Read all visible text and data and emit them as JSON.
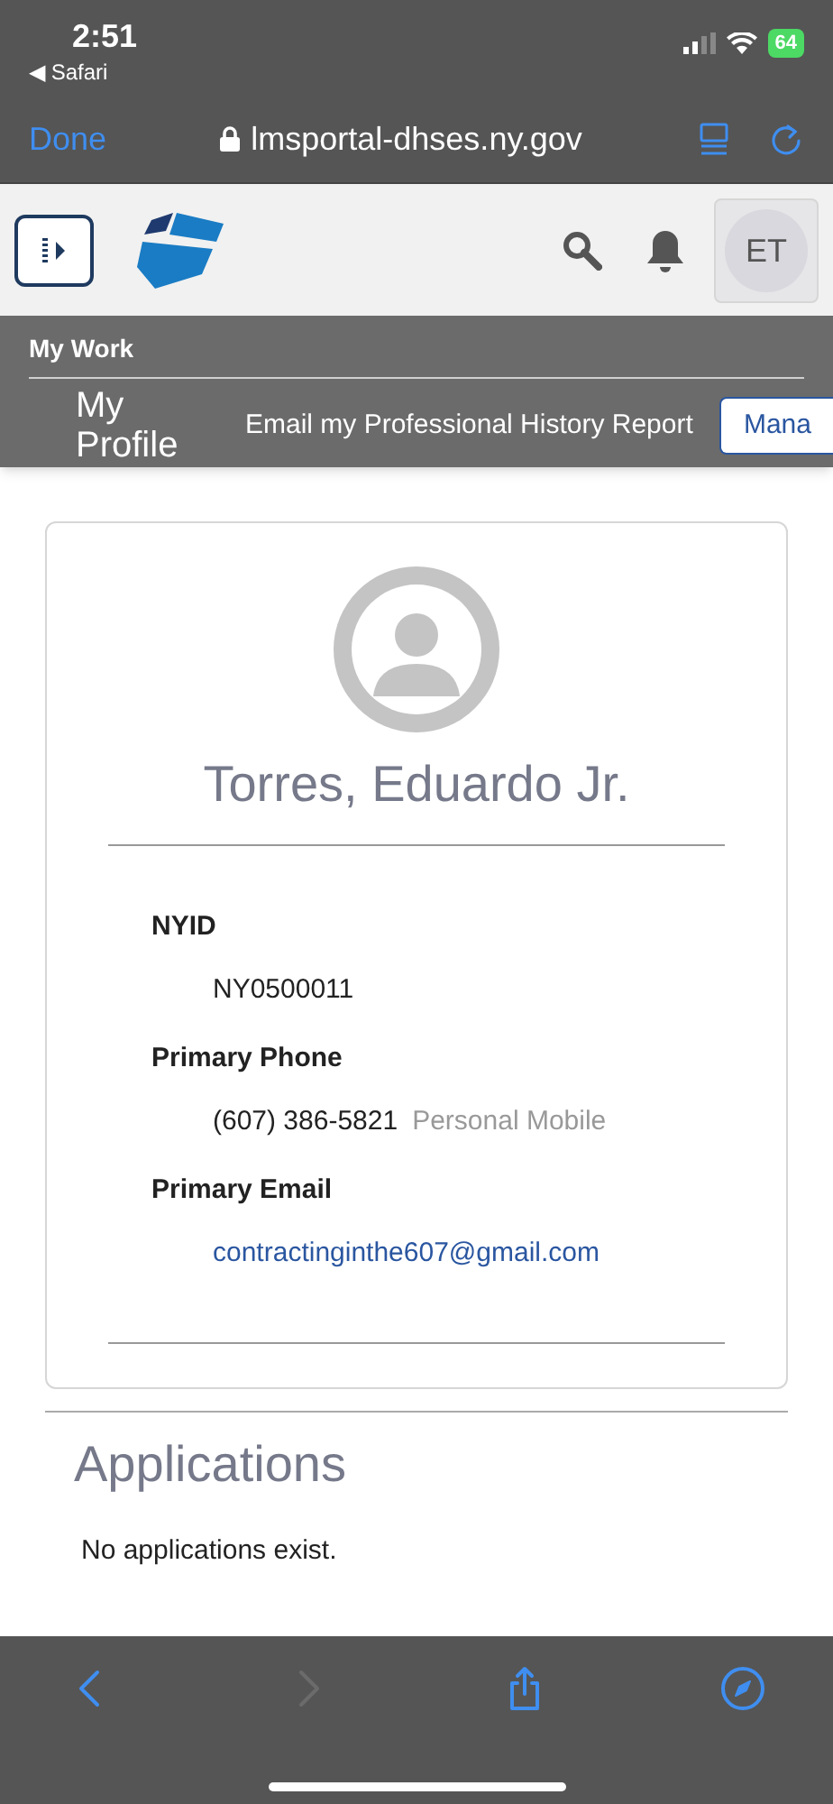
{
  "status_bar": {
    "time": "2:51",
    "back_app": "◀ Safari",
    "battery": "64"
  },
  "browser": {
    "done": "Done",
    "url": "lmsportal-dhses.ny.gov"
  },
  "header": {
    "avatar_initials": "ET"
  },
  "nav": {
    "section": "My Work",
    "page_title": "My Profile",
    "actions": [
      {
        "label": "Email my Professional History Report",
        "kind": "link"
      },
      {
        "label": "Mana",
        "kind": "button"
      }
    ]
  },
  "profile": {
    "name": "Torres, Eduardo Jr.",
    "fields": [
      {
        "label": "NYID",
        "value": "NY0500011",
        "kind": "text"
      },
      {
        "label": "Primary Phone",
        "value": "(607) 386-5821",
        "note": "Personal Mobile",
        "kind": "text"
      },
      {
        "label": "Primary Email",
        "value": "contractinginthe607@gmail.com",
        "kind": "link"
      }
    ]
  },
  "applications": {
    "title": "Applications",
    "empty_message": "No applications exist."
  },
  "toolbar": [
    {
      "kind": "back",
      "disabled": false
    },
    {
      "kind": "forward",
      "disabled": true
    },
    {
      "kind": "share",
      "disabled": false
    },
    {
      "kind": "compass",
      "disabled": false
    }
  ]
}
